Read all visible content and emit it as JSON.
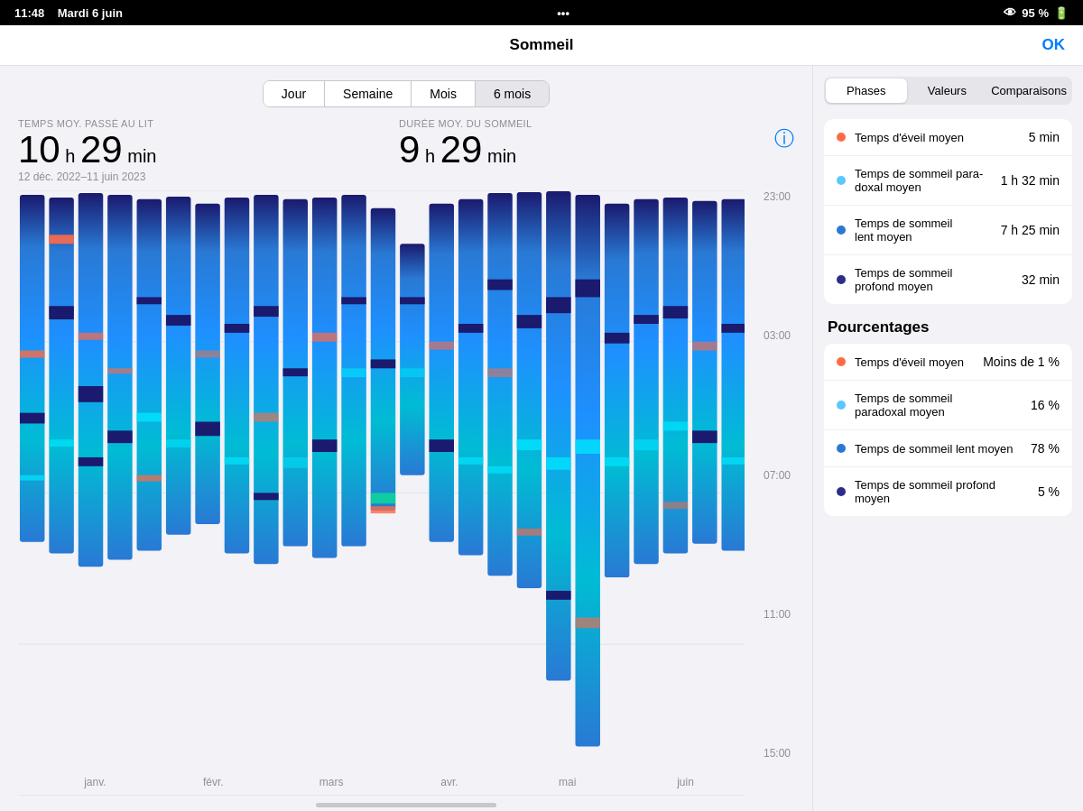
{
  "statusBar": {
    "time": "11:48",
    "day": "Mardi 6 juin",
    "dots": "•••",
    "battery": "95 %",
    "batteryIcon": "🔋"
  },
  "header": {
    "title": "Sommeil",
    "okButton": "OK"
  },
  "periodTabs": [
    {
      "label": "Jour",
      "active": false
    },
    {
      "label": "Semaine",
      "active": false
    },
    {
      "label": "Mois",
      "active": false
    },
    {
      "label": "6 mois",
      "active": true
    }
  ],
  "stats": {
    "timeInBed": {
      "label": "TEMPS MOY. PASSÉ AU LIT",
      "hours": "10",
      "hUnit": "h",
      "minutes": "29",
      "mUnit": "min"
    },
    "sleepDuration": {
      "label": "DURÉE MOY. DU SOMMEIL",
      "hours": "9",
      "hUnit": "h",
      "minutes": "29",
      "mUnit": "min"
    },
    "dateRange": "12 déc. 2022–11 juin 2023"
  },
  "chart": {
    "timeLabels": [
      "23:00",
      "03:00",
      "07:00",
      "11:00",
      "15:00"
    ],
    "monthLabels": [
      "janv.",
      "févr.",
      "mars",
      "avr.",
      "mai",
      "juin"
    ]
  },
  "rightPanel": {
    "tabs": [
      {
        "label": "Phases",
        "active": true
      },
      {
        "label": "Valeurs",
        "active": false
      },
      {
        "label": "Comparaisons",
        "active": false
      }
    ],
    "averages": {
      "title": "",
      "items": [
        {
          "dot": "orange",
          "label": "Temps d'éveil moyen",
          "value": "5 min"
        },
        {
          "dot": "lightblue",
          "label": "Temps de sommeil para-\ndoxal moyen",
          "value": "1 h 32 min"
        },
        {
          "dot": "blue",
          "label": "Temps de sommeil\nlent moyen",
          "value": "7 h 25 min"
        },
        {
          "dot": "darkblue",
          "label": "Temps de sommeil\nprofond moyen",
          "value": "32 min"
        }
      ]
    },
    "percentages": {
      "title": "Pourcentages",
      "items": [
        {
          "dot": "orange",
          "label": "Temps d'éveil moyen",
          "value": "Moins de 1 %"
        },
        {
          "dot": "lightblue",
          "label": "Temps de sommeil\nparadoxal moyen",
          "value": "16 %"
        },
        {
          "dot": "blue",
          "label": "Temps de sommeil lent moyen",
          "value": "78 %"
        },
        {
          "dot": "darkblue",
          "label": "Temps de sommeil profond moyen",
          "value": "5 %"
        }
      ]
    }
  },
  "scrollIndicator": {}
}
